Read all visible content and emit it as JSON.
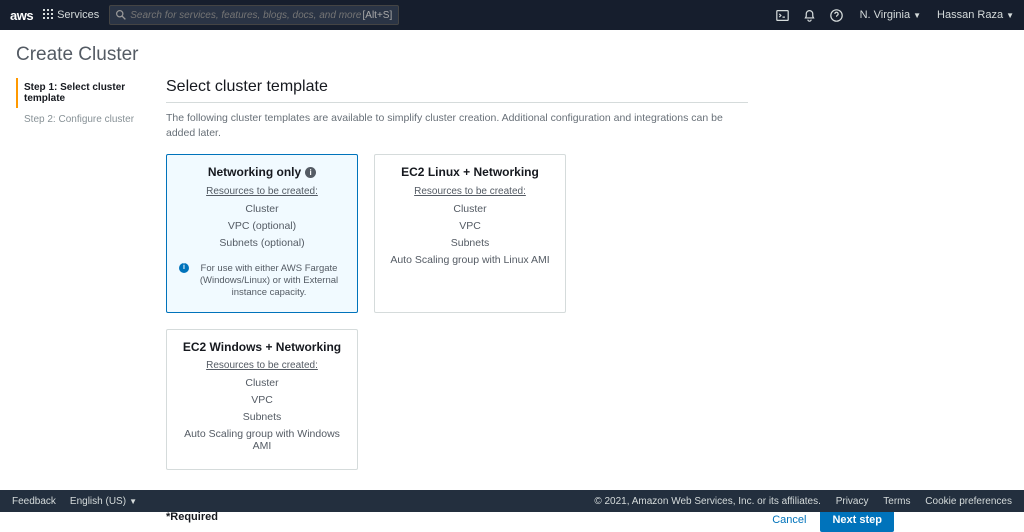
{
  "nav": {
    "logo": "aws",
    "services": "Services",
    "search_placeholder": "Search for services, features, blogs, docs, and more",
    "search_kbd": "[Alt+S]",
    "region": "N. Virginia",
    "user": "Hassan Raza"
  },
  "page_title": "Create Cluster",
  "steps": [
    {
      "label": "Step 1: Select cluster template",
      "active": true
    },
    {
      "label": "Step 2: Configure cluster",
      "active": false
    }
  ],
  "section_title": "Select cluster template",
  "intro": "The following cluster templates are available to simplify cluster creation. Additional configuration and integrations can be added later.",
  "resources_header": "Resources to be created:",
  "templates": [
    {
      "title": "Networking only",
      "selected": true,
      "info_icon": true,
      "resources": [
        "Cluster",
        "VPC (optional)",
        "Subnets (optional)"
      ],
      "note": "For use with either AWS Fargate (Windows/Linux) or with External instance capacity."
    },
    {
      "title": "EC2 Linux + Networking",
      "selected": false,
      "info_icon": false,
      "resources": [
        "Cluster",
        "VPC",
        "Subnets",
        "Auto Scaling group with Linux AMI"
      ]
    },
    {
      "title": "EC2 Windows + Networking",
      "selected": false,
      "info_icon": false,
      "resources": [
        "Cluster",
        "VPC",
        "Subnets",
        "Auto Scaling group with Windows AMI"
      ]
    }
  ],
  "required_label": "*Required",
  "actions": {
    "cancel": "Cancel",
    "next": "Next step"
  },
  "footer": {
    "feedback": "Feedback",
    "language": "English (US)",
    "copyright": "© 2021, Amazon Web Services, Inc. or its affiliates.",
    "links": [
      "Privacy",
      "Terms",
      "Cookie preferences"
    ]
  }
}
